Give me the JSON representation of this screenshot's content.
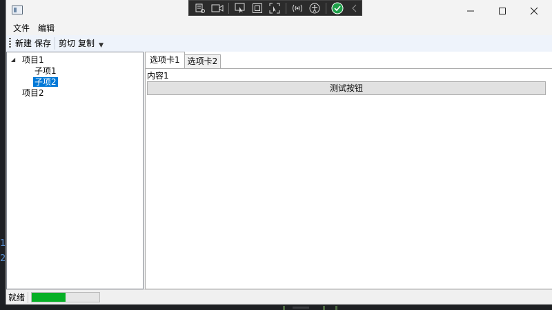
{
  "window": {
    "title": ""
  },
  "menu": [
    {
      "label": "文件"
    },
    {
      "label": "编辑"
    }
  ],
  "toolbar": {
    "buttons": [
      {
        "label": "新建"
      },
      {
        "label": "保存"
      },
      {
        "label": "剪切"
      },
      {
        "label": "复制"
      }
    ]
  },
  "tree": [
    {
      "label": "项目1",
      "expanded": true,
      "children": [
        {
          "label": "子项1",
          "selected": false
        },
        {
          "label": "子项2",
          "selected": true
        }
      ]
    },
    {
      "label": "项目2",
      "expanded": false
    }
  ],
  "tabs": [
    {
      "label": "选项卡1",
      "active": true
    },
    {
      "label": "选项卡2",
      "active": false
    }
  ],
  "tab_content": {
    "label": "内容1",
    "button_label": "测试按钮"
  },
  "status": {
    "text": "就绪",
    "progress": 0.5,
    "progress_color": "#06b025"
  },
  "background": {
    "numbers": [
      "1",
      "2"
    ]
  },
  "debug_toolbar": {
    "icons": [
      "visual-tree-icon",
      "record-icon",
      "select-element-icon",
      "display-layout-icon",
      "track-focus-icon",
      "hot-reload-icon",
      "accessibility-icon",
      "check-icon",
      "collapse-icon"
    ]
  },
  "colors": {
    "selection": "#0078d7",
    "toolbar_bg": "#eef3fb"
  }
}
